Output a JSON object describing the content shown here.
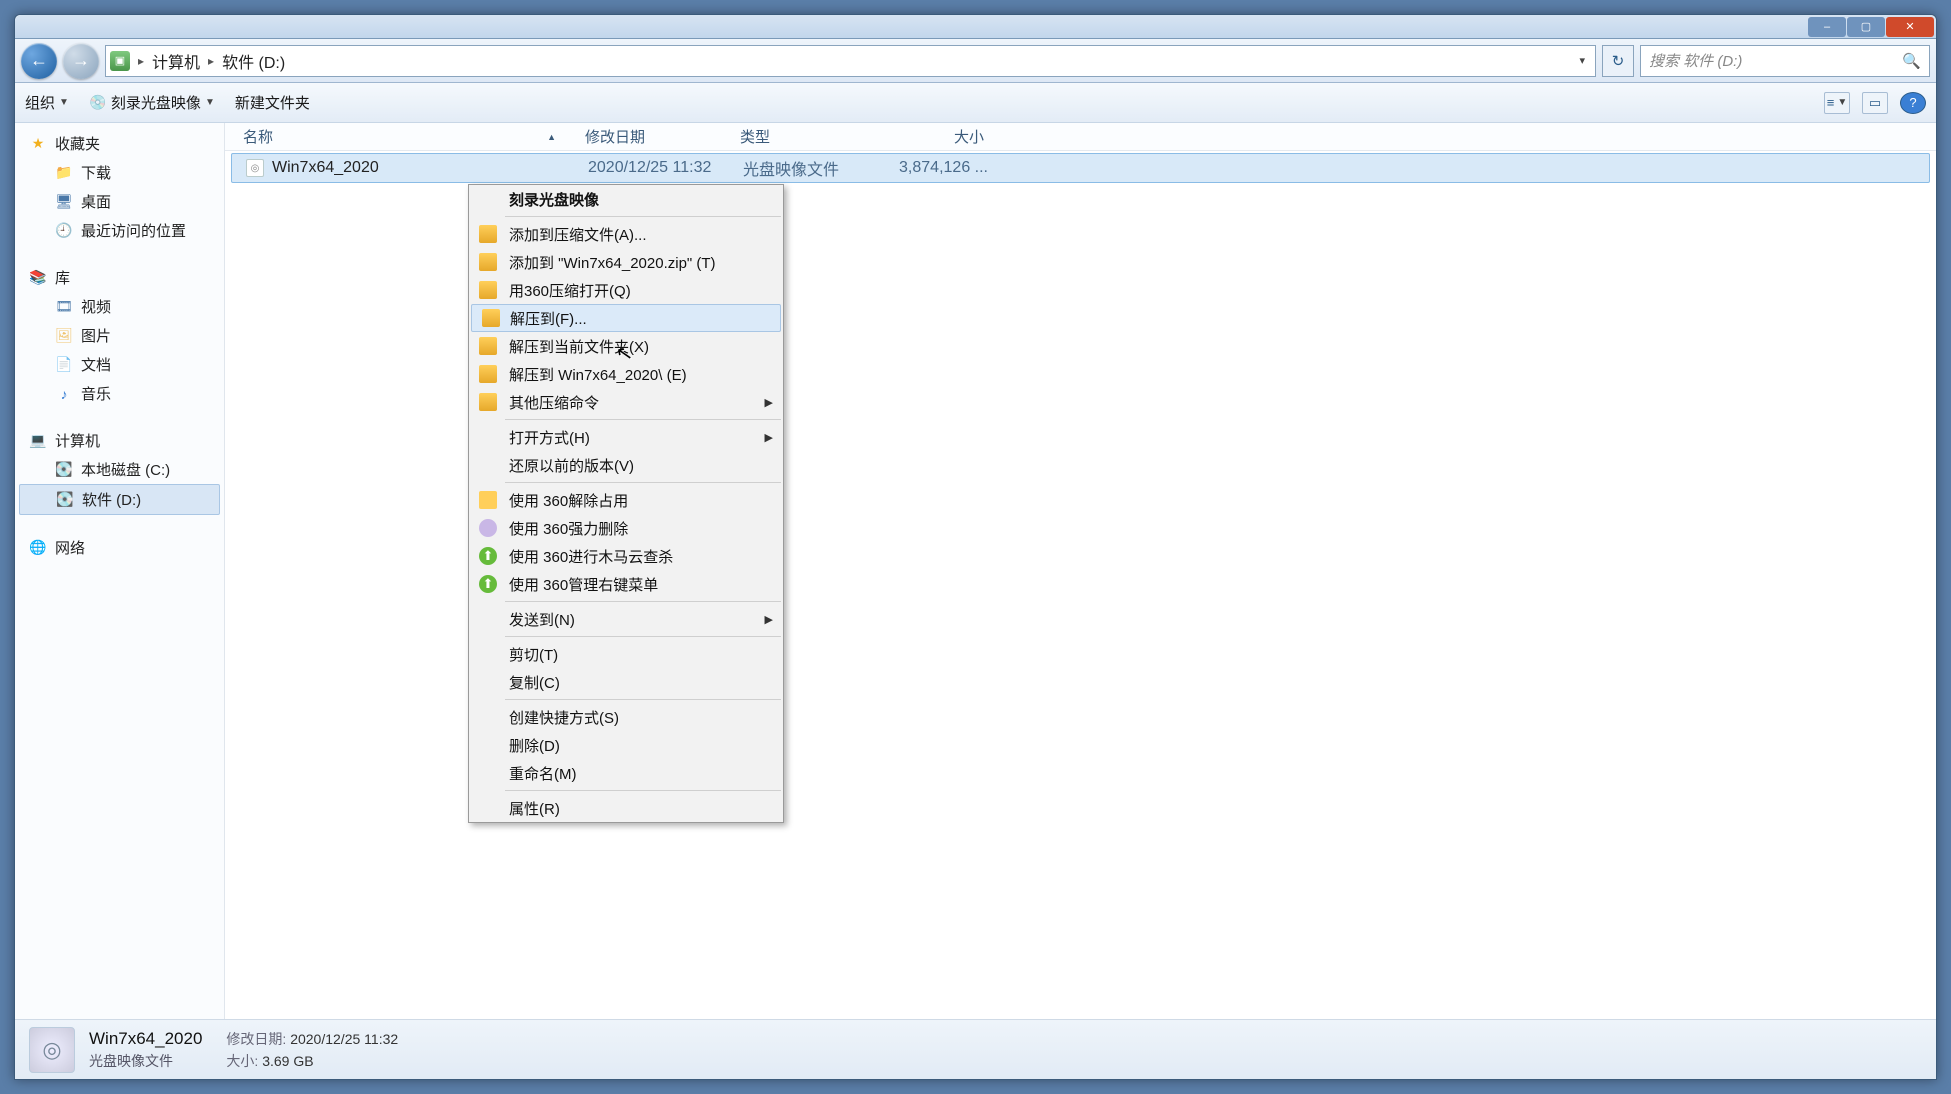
{
  "window_controls": {
    "min": "–",
    "max": "▢",
    "close": "✕"
  },
  "nav": {
    "back": "←",
    "forward": "→",
    "refresh": "↻"
  },
  "breadcrumb": {
    "root_icon": "▣",
    "sep": "▸",
    "parts": [
      "计算机",
      "软件 (D:)"
    ]
  },
  "search": {
    "placeholder": "搜索 软件 (D:)"
  },
  "toolbar": {
    "organize": "组织",
    "burn": "刻录光盘映像",
    "newfolder": "新建文件夹",
    "view_icon": "≡",
    "preview_icon": "▭",
    "help_icon": "?"
  },
  "sidebar": {
    "favorites": {
      "label": "收藏夹",
      "items": [
        "下载",
        "桌面",
        "最近访问的位置"
      ]
    },
    "libraries": {
      "label": "库",
      "items": [
        "视频",
        "图片",
        "文档",
        "音乐"
      ]
    },
    "computer": {
      "label": "计算机",
      "items": [
        "本地磁盘 (C:)",
        "软件 (D:)"
      ]
    },
    "network": {
      "label": "网络"
    }
  },
  "columns": {
    "name": "名称",
    "date": "修改日期",
    "type": "类型",
    "size": "大小"
  },
  "files": [
    {
      "name": "Win7x64_2020",
      "date": "2020/12/25 11:32",
      "type": "光盘映像文件",
      "size": "3,874,126 ..."
    }
  ],
  "context_menu": {
    "items": [
      {
        "label": "刻录光盘映像",
        "bold": true
      },
      {
        "sep": true
      },
      {
        "label": "添加到压缩文件(A)...",
        "icon": "zip"
      },
      {
        "label": "添加到 \"Win7x64_2020.zip\" (T)",
        "icon": "zip"
      },
      {
        "label": "用360压缩打开(Q)",
        "icon": "zip"
      },
      {
        "label": "解压到(F)...",
        "icon": "zip",
        "hover": true
      },
      {
        "label": "解压到当前文件夹(X)",
        "icon": "zip"
      },
      {
        "label": "解压到 Win7x64_2020\\ (E)",
        "icon": "zip"
      },
      {
        "label": "其他压缩命令",
        "icon": "zip",
        "submenu": true
      },
      {
        "sep": true
      },
      {
        "label": "打开方式(H)",
        "submenu": true
      },
      {
        "label": "还原以前的版本(V)"
      },
      {
        "sep": true
      },
      {
        "label": "使用 360解除占用",
        "icon": "360o"
      },
      {
        "label": "使用 360强力删除",
        "icon": "360p"
      },
      {
        "label": "使用 360进行木马云查杀",
        "icon": "360g"
      },
      {
        "label": "使用 360管理右键菜单",
        "icon": "360g"
      },
      {
        "sep": true
      },
      {
        "label": "发送到(N)",
        "submenu": true
      },
      {
        "sep": true
      },
      {
        "label": "剪切(T)"
      },
      {
        "label": "复制(C)"
      },
      {
        "sep": true
      },
      {
        "label": "创建快捷方式(S)"
      },
      {
        "label": "删除(D)"
      },
      {
        "label": "重命名(M)"
      },
      {
        "sep": true
      },
      {
        "label": "属性(R)"
      }
    ]
  },
  "status": {
    "title": "Win7x64_2020",
    "subtitle": "光盘映像文件",
    "date_label": "修改日期:",
    "date_value": "2020/12/25 11:32",
    "size_label": "大小:",
    "size_value": "3.69 GB"
  }
}
